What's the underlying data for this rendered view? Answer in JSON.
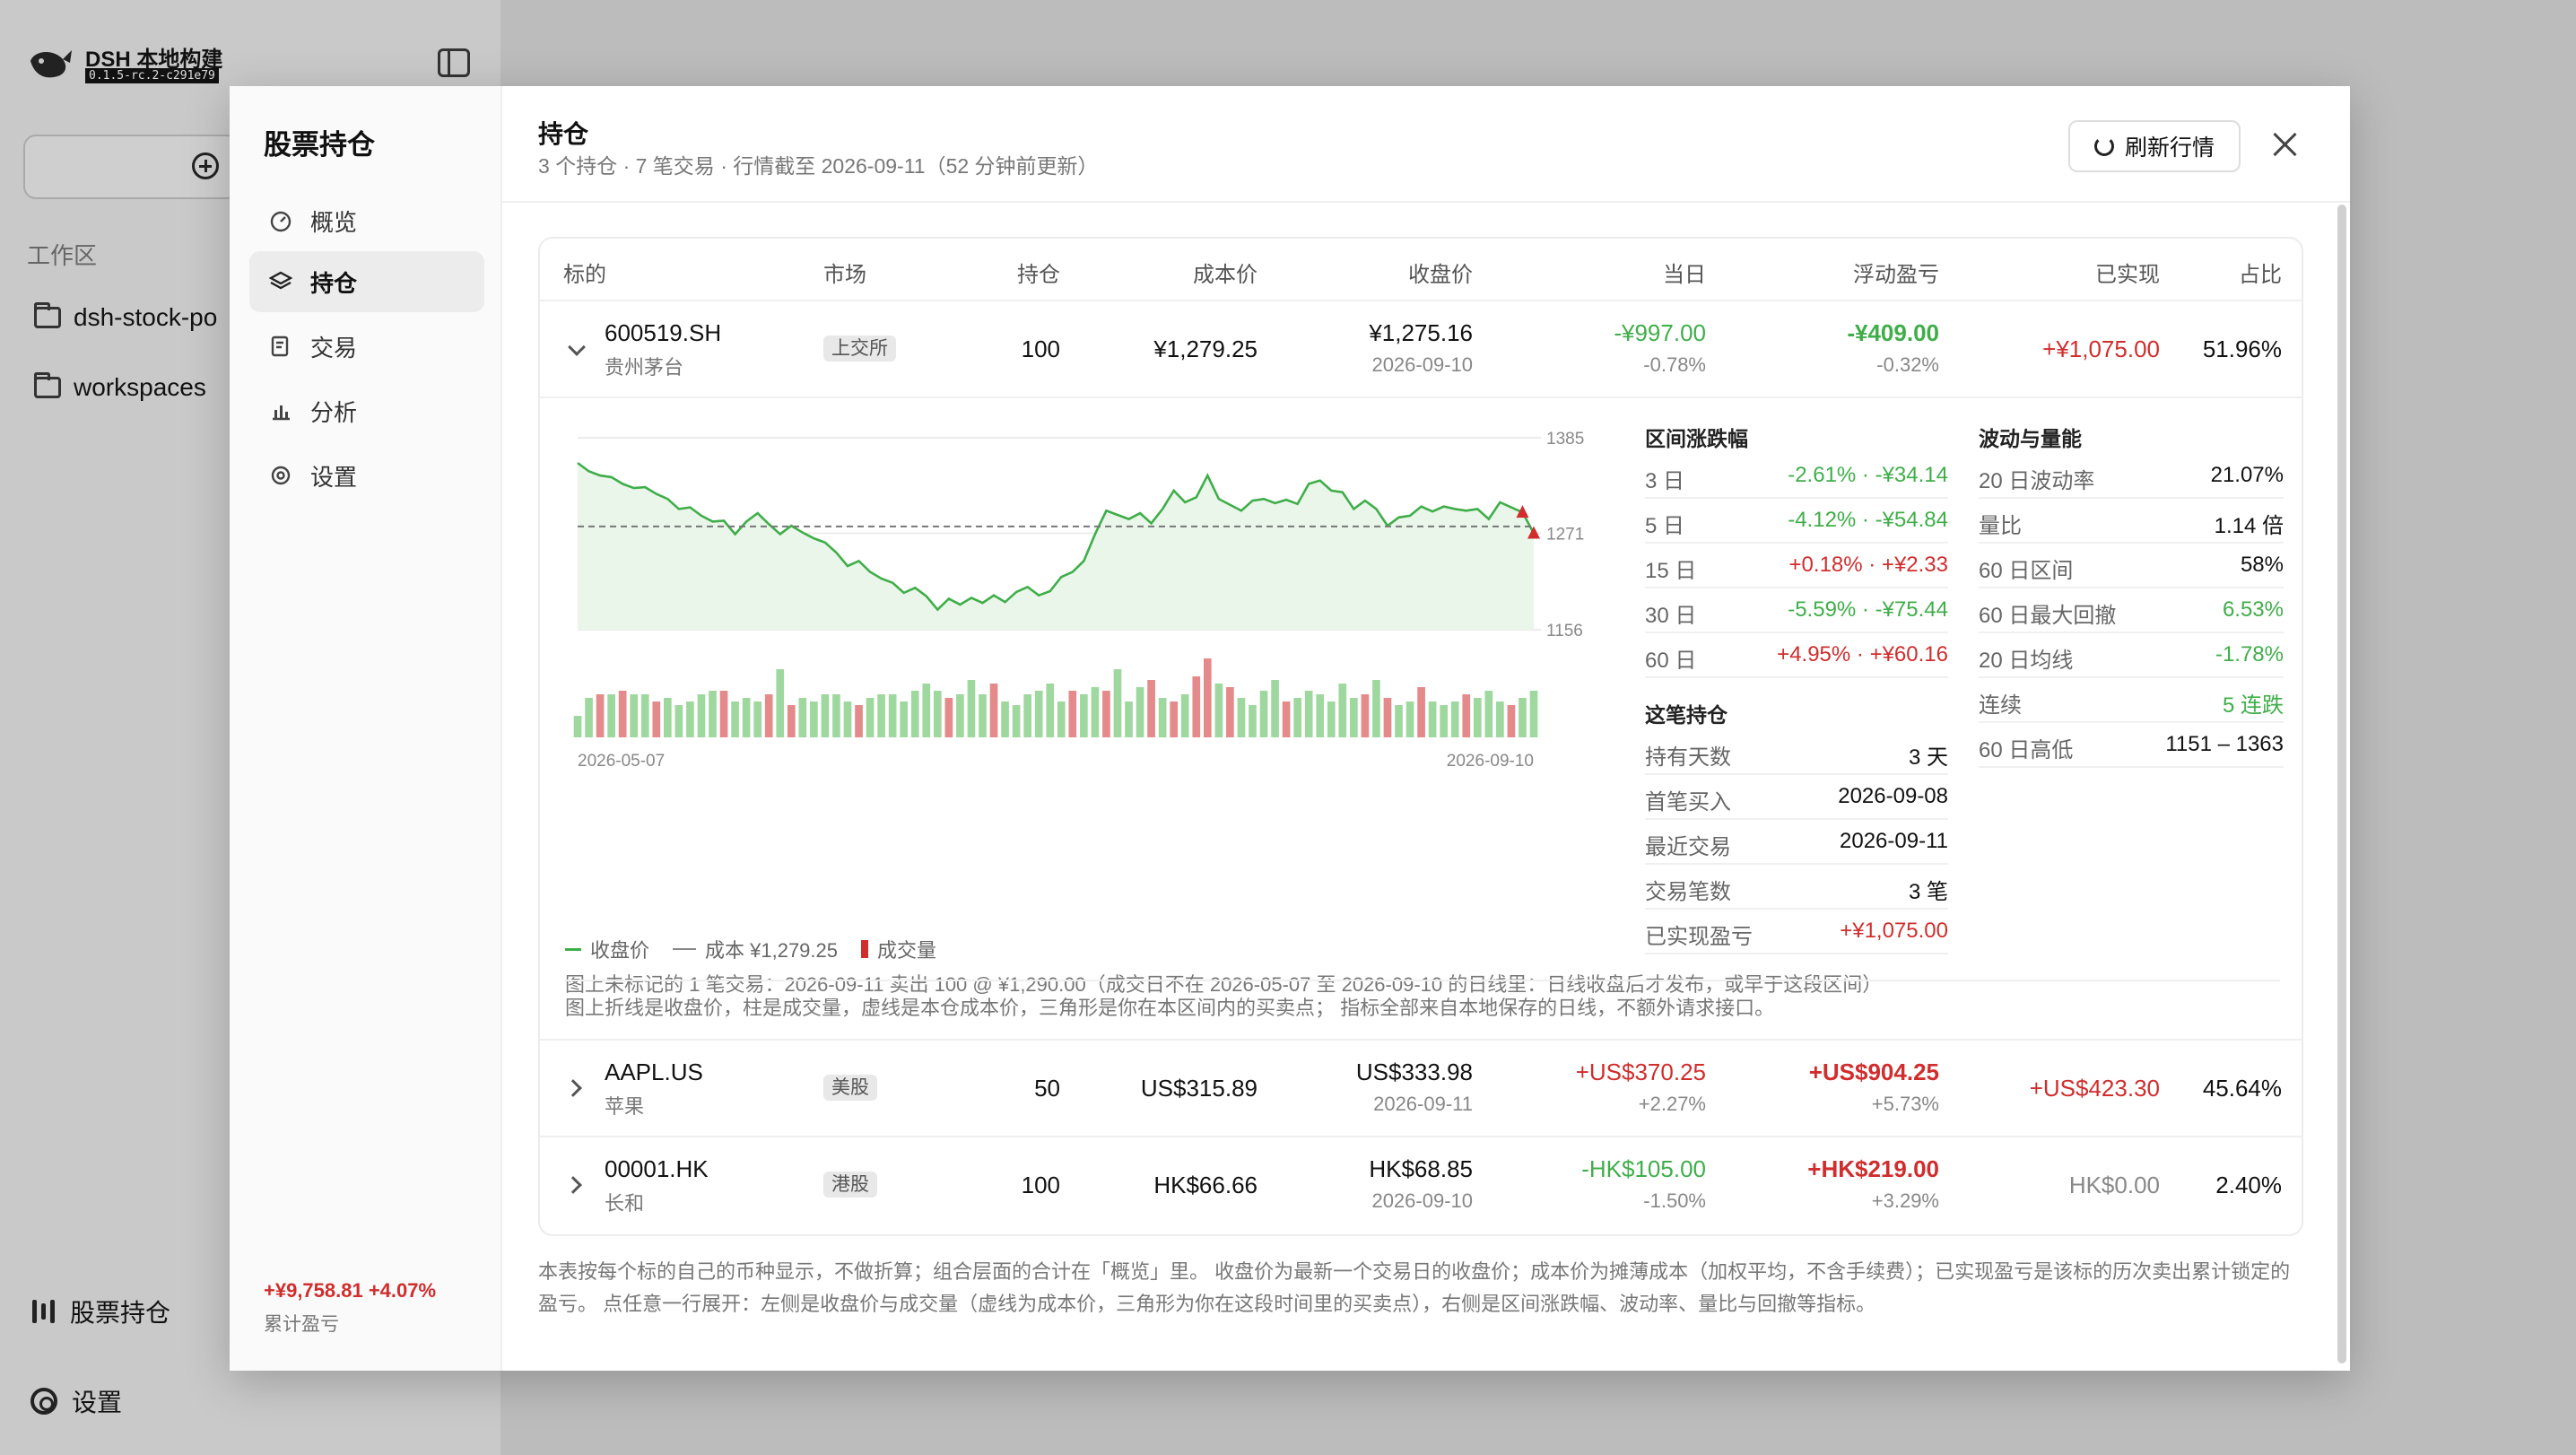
{
  "app": {
    "title": "DSH 本地构建",
    "version": "0.1.5-rc.2-c291e79",
    "section": "工作区",
    "folders": [
      "dsh-stock-po",
      "workspaces"
    ],
    "bottom_items": [
      "股票持仓",
      "设置"
    ]
  },
  "modal": {
    "nav_title": "股票持仓",
    "nav": [
      {
        "label": "概览",
        "icon": "gauge-icon"
      },
      {
        "label": "持仓",
        "icon": "layers-icon"
      },
      {
        "label": "交易",
        "icon": "receipt-icon"
      },
      {
        "label": "分析",
        "icon": "bar-chart-icon"
      },
      {
        "label": "设置",
        "icon": "gear-icon"
      }
    ],
    "active_nav": "持仓",
    "total": "+¥9,758.81 +4.07%",
    "total_label": "累计盈亏",
    "title": "持仓",
    "subtitle": "3 个持仓 · 7 笔交易 · 行情截至 2026-09-11（52 分钟前更新）",
    "refresh_label": "刷新行情",
    "footnote": "本表按每个标的自己的币种显示，不做折算；组合层面的合计在「概览」里。 收盘价为最新一个交易日的收盘价；成本价为摊薄成本（加权平均，不含手续费）；已实现盈亏是该标的历次卖出累计锁定的盈亏。 点任意一行展开：左侧是收盘价与成交量（虚线为成本价，三角形为你在这段时间里的买卖点），右侧是区间涨跌幅、波动率、量比与回撤等指标。"
  },
  "table": {
    "headers": [
      "标的",
      "市场",
      "持仓",
      "成本价",
      "收盘价",
      "当日",
      "浮动盈亏",
      "已实现",
      "占比"
    ],
    "rows": [
      {
        "symbol": "600519.SH",
        "name": "贵州茅台",
        "market": "上交所",
        "qty": "100",
        "cost": "¥1,279.25",
        "close": "¥1,275.16",
        "close_date": "2026-09-10",
        "day": "-¥997.00",
        "day_pct": "-0.78%",
        "pnl": "-¥409.00",
        "pnl_pct": "-0.32%",
        "realized": "+¥1,075.00",
        "weight": "51.96%",
        "day_color": "#3fae49",
        "pnl_color": "#3fae49",
        "realized_color": "#d12d2d",
        "expanded": true
      },
      {
        "symbol": "AAPL.US",
        "name": "苹果",
        "market": "美股",
        "qty": "50",
        "cost": "US$315.89",
        "close": "US$333.98",
        "close_date": "2026-09-11",
        "day": "+US$370.25",
        "day_pct": "+2.27%",
        "pnl": "+US$904.25",
        "pnl_pct": "+5.73%",
        "realized": "+US$423.30",
        "weight": "45.64%",
        "day_color": "#d12d2d",
        "pnl_color": "#d12d2d",
        "realized_color": "#d12d2d",
        "expanded": false
      },
      {
        "symbol": "00001.HK",
        "name": "长和",
        "market": "港股",
        "qty": "100",
        "cost": "HK$66.66",
        "close": "HK$68.85",
        "close_date": "2026-09-10",
        "day": "-HK$105.00",
        "day_pct": "-1.50%",
        "pnl": "+HK$219.00",
        "pnl_pct": "+3.29%",
        "realized": "HK$0.00",
        "weight": "2.40%",
        "day_color": "#3fae49",
        "pnl_color": "#d12d2d",
        "realized_color": "#888888",
        "expanded": false
      }
    ]
  },
  "detail": {
    "chart_data": {
      "type": "line",
      "x_start": "2026-05-07",
      "x_end": "2026-09-10",
      "y_ticks": [
        1385,
        1271,
        1156
      ],
      "ylim": [
        1156,
        1385
      ],
      "cost_line": 1279.25,
      "close": [
        1355,
        1345,
        1340,
        1338,
        1330,
        1325,
        1326,
        1318,
        1312,
        1300,
        1302,
        1292,
        1285,
        1286,
        1270,
        1285,
        1295,
        1282,
        1270,
        1280,
        1272,
        1265,
        1260,
        1248,
        1232,
        1238,
        1225,
        1217,
        1212,
        1200,
        1206,
        1196,
        1180,
        1193,
        1186,
        1194,
        1188,
        1197,
        1189,
        1201,
        1207,
        1197,
        1202,
        1219,
        1225,
        1238,
        1270,
        1298,
        1293,
        1288,
        1295,
        1283,
        1300,
        1322,
        1308,
        1314,
        1340,
        1312,
        1305,
        1298,
        1310,
        1312,
        1307,
        1311,
        1306,
        1330,
        1334,
        1322,
        1320,
        1300,
        1310,
        1300,
        1280,
        1290,
        1292,
        1303,
        1297,
        1303,
        1300,
        1298,
        1300,
        1288,
        1308,
        1302,
        1296,
        1271
      ],
      "volume": [
        12,
        22,
        24,
        24,
        26,
        24,
        24,
        20,
        22,
        18,
        20,
        24,
        26,
        26,
        20,
        22,
        20,
        24,
        38,
        18,
        22,
        20,
        24,
        24,
        20,
        18,
        22,
        24,
        24,
        20,
        26,
        30,
        26,
        22,
        24,
        32,
        24,
        30,
        20,
        18,
        24,
        26,
        30,
        20,
        26,
        24,
        28,
        26,
        38,
        20,
        28,
        32,
        22,
        20,
        24,
        34,
        44,
        30,
        28,
        22,
        18,
        26,
        32,
        20,
        22,
        26,
        24,
        20,
        30,
        22,
        24,
        32,
        22,
        18,
        20,
        28,
        20,
        18,
        20,
        24,
        22,
        26,
        20,
        18,
        22,
        26
      ],
      "volume_colors_red": [
        2,
        4,
        7,
        13,
        17,
        19,
        25,
        33,
        37,
        44,
        47,
        51,
        53,
        55,
        56,
        58,
        63,
        70,
        72,
        75,
        79,
        83
      ],
      "markers": [
        {
          "index": 84,
          "side": "buy"
        },
        {
          "index": 85,
          "side": "sell"
        }
      ],
      "legend": [
        "收盘价",
        "成本 ¥1,279.25",
        "成交量"
      ]
    },
    "chart_note": "图上未标记的 1 笔交易：2026-09-11 卖出 100 @ ¥1,290.00（成交日不在 2026-05-07 至 2026-09-10 的日线里：日线收盘后才发布，或早于这段区间）",
    "range_title": "区间涨跌幅",
    "range": [
      {
        "label": "3 日",
        "value": "-2.61% · -¥34.14",
        "color": "#3fae49"
      },
      {
        "label": "5 日",
        "value": "-4.12% · -¥54.84",
        "color": "#3fae49"
      },
      {
        "label": "15 日",
        "value": "+0.18% · +¥2.33",
        "color": "#d12d2d"
      },
      {
        "label": "30 日",
        "value": "-5.59% · -¥75.44",
        "color": "#3fae49"
      },
      {
        "label": "60 日",
        "value": "+4.95% · +¥60.16",
        "color": "#d12d2d"
      }
    ],
    "vol_title": "波动与量能",
    "vol": [
      {
        "label": "20 日波动率",
        "value": "21.07%",
        "color": "#111111"
      },
      {
        "label": "量比",
        "value": "1.14 倍",
        "color": "#111111"
      },
      {
        "label": "60 日区间",
        "value": "58%",
        "color": "#111111"
      },
      {
        "label": "60 日最大回撤",
        "value": "6.53%",
        "color": "#3fae49"
      },
      {
        "label": "20 日均线",
        "value": "-1.78%",
        "color": "#3fae49"
      },
      {
        "label": "连续",
        "value": "5 连跌",
        "color": "#3fae49"
      },
      {
        "label": "60 日高低",
        "value": "1151 – 1363",
        "color": "#111111"
      }
    ],
    "hold_title": "这笔持仓",
    "hold": [
      {
        "label": "持有天数",
        "value": "3 天",
        "color": "#111111"
      },
      {
        "label": "首笔买入",
        "value": "2026-09-08",
        "color": "#111111"
      },
      {
        "label": "最近交易",
        "value": "2026-09-11",
        "color": "#111111"
      },
      {
        "label": "交易笔数",
        "value": "3 笔",
        "color": "#111111"
      },
      {
        "label": "已实现盈亏",
        "value": "+¥1,075.00",
        "color": "#d12d2d"
      }
    ],
    "bottom_note": "图上折线是收盘价，柱是成交量，虚线是本仓成本价，三角形是你在本区间内的买卖点； 指标全部来自本地保存的日线，不额外请求接口。"
  }
}
